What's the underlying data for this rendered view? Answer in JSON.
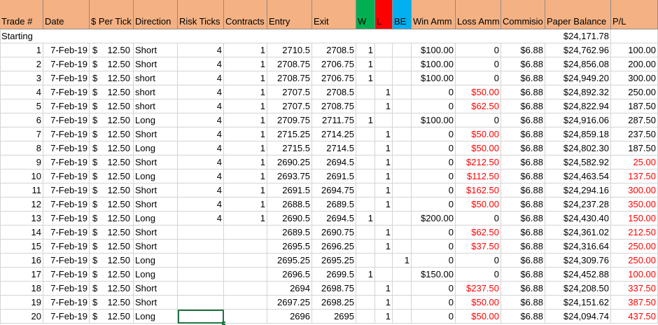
{
  "header": {
    "trade_no": "Trade #",
    "date": "Date",
    "per_tick": "$ Per Tick",
    "direction": "Direction",
    "risk_ticks": "Risk Ticks",
    "contracts": "Contracts",
    "entry": "Entry",
    "exit": "Exit",
    "w": "W",
    "l": "L",
    "be": "BE",
    "win_amm": "Win Amm",
    "loss_amm": "Loss Amm",
    "commission": "Commisio",
    "paper_balance": "Paper Balance",
    "pl": "P/L"
  },
  "header_colors": {
    "default": "#f4b183",
    "w": "#00b050",
    "l": "#ff0000",
    "be": "#00b0f0"
  },
  "starting": {
    "label": "Starting",
    "balance": "$24,171.78"
  },
  "rows": [
    {
      "n": "1",
      "date": "7-Feb-19",
      "tick": "12.50",
      "dir": "Short",
      "risk": "4",
      "con": "1",
      "entry": "2710.5",
      "exit": "2708.5",
      "w": "1",
      "l": "",
      "be": "",
      "win": "$100.00",
      "loss": "0",
      "loss_red": false,
      "comm": "$6.88",
      "bal": "$24,762.96",
      "pl": "100.00",
      "pl_red": false
    },
    {
      "n": "2",
      "date": "7-Feb-19",
      "tick": "12.50",
      "dir": "Short",
      "risk": "4",
      "con": "1",
      "entry": "2708.75",
      "exit": "2706.75",
      "w": "1",
      "l": "",
      "be": "",
      "win": "$100.00",
      "loss": "0",
      "loss_red": false,
      "comm": "$6.88",
      "bal": "$24,856.08",
      "pl": "200.00",
      "pl_red": false
    },
    {
      "n": "3",
      "date": "7-Feb-19",
      "tick": "12.50",
      "dir": "short",
      "risk": "4",
      "con": "1",
      "entry": "2708.75",
      "exit": "2706.75",
      "w": "1",
      "l": "",
      "be": "",
      "win": "$100.00",
      "loss": "0",
      "loss_red": false,
      "comm": "$6.88",
      "bal": "$24,949.20",
      "pl": "300.00",
      "pl_red": false
    },
    {
      "n": "4",
      "date": "7-Feb-19",
      "tick": "12.50",
      "dir": "short",
      "risk": "4",
      "con": "1",
      "entry": "2707.5",
      "exit": "2708.5",
      "w": "",
      "l": "1",
      "be": "",
      "win": "0",
      "loss": "$50.00",
      "loss_red": true,
      "comm": "$6.88",
      "bal": "$24,892.32",
      "pl": "250.00",
      "pl_red": false
    },
    {
      "n": "5",
      "date": "7-Feb-19",
      "tick": "12.50",
      "dir": "short",
      "risk": "4",
      "con": "1",
      "entry": "2707.5",
      "exit": "2708.75",
      "w": "",
      "l": "1",
      "be": "",
      "win": "0",
      "loss": "$62.50",
      "loss_red": true,
      "comm": "$6.88",
      "bal": "$24,822.94",
      "pl": "187.50",
      "pl_red": false
    },
    {
      "n": "6",
      "date": "7-Feb-19",
      "tick": "12.50",
      "dir": "Long",
      "risk": "4",
      "con": "1",
      "entry": "2709.75",
      "exit": "2711.75",
      "w": "1",
      "l": "",
      "be": "",
      "win": "$100.00",
      "loss": "0",
      "loss_red": false,
      "comm": "$6.88",
      "bal": "$24,916.06",
      "pl": "287.50",
      "pl_red": false
    },
    {
      "n": "7",
      "date": "7-Feb-19",
      "tick": "12.50",
      "dir": "Short",
      "risk": "4",
      "con": "1",
      "entry": "2715.25",
      "exit": "2714.25",
      "w": "",
      "l": "1",
      "be": "",
      "win": "0",
      "loss": "$50.00",
      "loss_red": true,
      "comm": "$6.88",
      "bal": "$24,859.18",
      "pl": "237.50",
      "pl_red": false
    },
    {
      "n": "8",
      "date": "7-Feb-19",
      "tick": "12.50",
      "dir": "Long",
      "risk": "4",
      "con": "1",
      "entry": "2715.5",
      "exit": "2714.5",
      "w": "",
      "l": "1",
      "be": "",
      "win": "0",
      "loss": "$50.00",
      "loss_red": true,
      "comm": "$6.88",
      "bal": "$24,802.30",
      "pl": "187.50",
      "pl_red": false
    },
    {
      "n": "9",
      "date": "7-Feb-19",
      "tick": "12.50",
      "dir": "Short",
      "risk": "4",
      "con": "1",
      "entry": "2690.25",
      "exit": "2694.5",
      "w": "",
      "l": "1",
      "be": "",
      "win": "0",
      "loss": "$212.50",
      "loss_red": true,
      "comm": "$6.88",
      "bal": "$24,582.92",
      "pl": "25.00",
      "pl_red": true
    },
    {
      "n": "10",
      "date": "7-Feb-19",
      "tick": "12.50",
      "dir": "Long",
      "risk": "4",
      "con": "1",
      "entry": "2693.75",
      "exit": "2691.5",
      "w": "",
      "l": "1",
      "be": "",
      "win": "0",
      "loss": "$112.50",
      "loss_red": true,
      "comm": "$6.88",
      "bal": "$24,463.54",
      "pl": "137.50",
      "pl_red": true
    },
    {
      "n": "11",
      "date": "7-Feb-19",
      "tick": "12.50",
      "dir": "Short",
      "risk": "4",
      "con": "1",
      "entry": "2691.5",
      "exit": "2694.75",
      "w": "",
      "l": "1",
      "be": "",
      "win": "0",
      "loss": "$162.50",
      "loss_red": true,
      "comm": "$6.88",
      "bal": "$24,294.16",
      "pl": "300.00",
      "pl_red": true
    },
    {
      "n": "12",
      "date": "7-Feb-19",
      "tick": "12.50",
      "dir": "Short",
      "risk": "4",
      "con": "1",
      "entry": "2688.5",
      "exit": "2689.5",
      "w": "",
      "l": "1",
      "be": "",
      "win": "0",
      "loss": "$50.00",
      "loss_red": true,
      "comm": "$6.88",
      "bal": "$24,237.28",
      "pl": "350.00",
      "pl_red": true
    },
    {
      "n": "13",
      "date": "7-Feb-19",
      "tick": "12.50",
      "dir": "Long",
      "risk": "4",
      "con": "1",
      "entry": "2690.5",
      "exit": "2694.5",
      "w": "1",
      "l": "",
      "be": "",
      "win": "$200.00",
      "loss": "0",
      "loss_red": false,
      "comm": "$6.88",
      "bal": "$24,430.40",
      "pl": "150.00",
      "pl_red": true
    },
    {
      "n": "14",
      "date": "7-Feb-19",
      "tick": "12.50",
      "dir": "Short",
      "risk": "",
      "con": "",
      "entry": "2689.5",
      "exit": "2690.75",
      "w": "",
      "l": "1",
      "be": "",
      "win": "0",
      "loss": "$62.50",
      "loss_red": true,
      "comm": "$6.88",
      "bal": "$24,361.02",
      "pl": "212.50",
      "pl_red": true
    },
    {
      "n": "15",
      "date": "7-Feb-19",
      "tick": "12.50",
      "dir": "Short",
      "risk": "",
      "con": "",
      "entry": "2695.5",
      "exit": "2696.25",
      "w": "",
      "l": "1",
      "be": "",
      "win": "0",
      "loss": "$37.50",
      "loss_red": true,
      "comm": "$6.88",
      "bal": "$24,316.64",
      "pl": "250.00",
      "pl_red": true
    },
    {
      "n": "16",
      "date": "7-Feb-19",
      "tick": "12.50",
      "dir": "Long",
      "risk": "",
      "con": "",
      "entry": "2695.25",
      "exit": "2695.25",
      "w": "",
      "l": "",
      "be": "1",
      "win": "0",
      "loss": "0",
      "loss_red": false,
      "comm": "$6.88",
      "bal": "$24,309.76",
      "pl": "250.00",
      "pl_red": true
    },
    {
      "n": "17",
      "date": "7-Feb-19",
      "tick": "12.50",
      "dir": "Long",
      "risk": "",
      "con": "",
      "entry": "2696.5",
      "exit": "2699.5",
      "w": "1",
      "l": "",
      "be": "",
      "win": "$150.00",
      "loss": "0",
      "loss_red": false,
      "comm": "$6.88",
      "bal": "$24,452.88",
      "pl": "100.00",
      "pl_red": true
    },
    {
      "n": "18",
      "date": "7-Feb-19",
      "tick": "12.50",
      "dir": "Short",
      "risk": "",
      "con": "",
      "entry": "2694",
      "exit": "2698.75",
      "w": "",
      "l": "1",
      "be": "",
      "win": "0",
      "loss": "$237.50",
      "loss_red": true,
      "comm": "$6.88",
      "bal": "$24,208.50",
      "pl": "337.50",
      "pl_red": true
    },
    {
      "n": "19",
      "date": "7-Feb-19",
      "tick": "12.50",
      "dir": "Short",
      "risk": "",
      "con": "",
      "entry": "2697.25",
      "exit": "2698.25",
      "w": "",
      "l": "1",
      "be": "",
      "win": "0",
      "loss": "$50.00",
      "loss_red": true,
      "comm": "$6.88",
      "bal": "$24,151.62",
      "pl": "387.50",
      "pl_red": true
    },
    {
      "n": "20",
      "date": "7-Feb-19",
      "tick": "12.50",
      "dir": "Long",
      "risk": "",
      "con": "",
      "entry": "2696",
      "exit": "2695",
      "w": "",
      "l": "1",
      "be": "",
      "win": "0",
      "loss": "$50.00",
      "loss_red": true,
      "comm": "$6.88",
      "bal": "$24,094.74",
      "pl": "437.50",
      "pl_red": true
    }
  ],
  "currency_symbol": "$",
  "selected_cell": {
    "row": "20",
    "column": "risk"
  }
}
